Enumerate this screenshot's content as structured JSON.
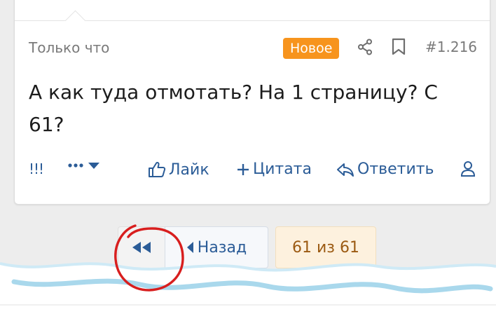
{
  "post": {
    "time": "Только что",
    "badge": "Новое",
    "number": "#1.216",
    "message": "А как туда отмотать? На 1 страницу? С 61?"
  },
  "actions": {
    "report_label": "!!!",
    "like_label": "Лайк",
    "quote_label": "Цитата",
    "reply_label": "Ответить"
  },
  "pager": {
    "back_label": "Назад",
    "count": "61 из 61"
  },
  "colors": {
    "accent": "#2b5c97",
    "badge": "#f7941d",
    "annotation": "#d81e1e",
    "tear_wave": "#a9d8ec"
  },
  "icons": [
    "share-icon",
    "bookmark-icon",
    "more-dots-icon",
    "thumbs-up-icon",
    "plus-icon",
    "reply-icon",
    "user-icon",
    "double-arrow-left-icon",
    "arrow-left-icon"
  ]
}
